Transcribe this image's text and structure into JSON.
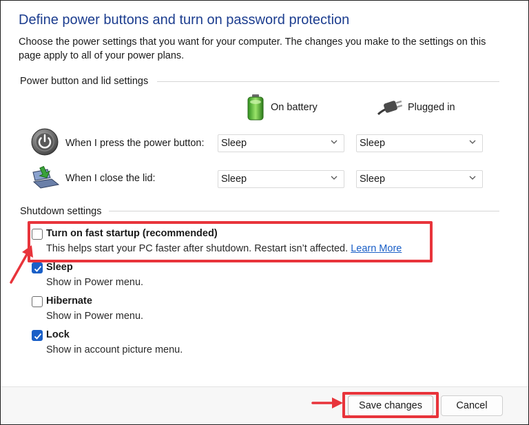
{
  "header": {
    "title": "Define power buttons and turn on password protection",
    "description": "Choose the power settings that you want for your computer. The changes you make to the settings on this page apply to all of your power plans."
  },
  "power_section": {
    "heading": "Power button and lid settings",
    "columns": {
      "battery": "On battery",
      "plugged": "Plugged in"
    },
    "rows": [
      {
        "label": "When I press the power button:",
        "battery": "Sleep",
        "plugged": "Sleep"
      },
      {
        "label": "When I close the lid:",
        "battery": "Sleep",
        "plugged": "Sleep"
      }
    ]
  },
  "shutdown_section": {
    "heading": "Shutdown settings",
    "options": [
      {
        "title": "Turn on fast startup (recommended)",
        "desc": "This helps start your PC faster after shutdown. Restart isn’t affected.",
        "link": "Learn More",
        "checked": false
      },
      {
        "title": "Sleep",
        "desc": "Show in Power menu.",
        "checked": true
      },
      {
        "title": "Hibernate",
        "desc": "Show in Power menu.",
        "checked": false
      },
      {
        "title": "Lock",
        "desc": "Show in account picture menu.",
        "checked": true
      }
    ]
  },
  "footer": {
    "save_label": "Save changes",
    "cancel_label": "Cancel"
  },
  "colors": {
    "title": "#1c3d8f",
    "checkbox_checked": "#1a5fc7",
    "annotation": "#e8343b"
  },
  "icons": {
    "battery": "battery-icon",
    "plug": "power-plug-icon",
    "power_button": "power-button-icon",
    "lid": "laptop-lid-icon"
  }
}
